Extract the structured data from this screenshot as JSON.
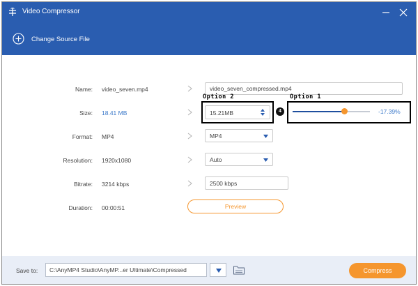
{
  "window": {
    "title": "Video Compressor"
  },
  "source": {
    "label": "Change Source File"
  },
  "rows": {
    "name": {
      "label": "Name:",
      "original": "video_seven.mp4",
      "output": "video_seven_compressed.mp4"
    },
    "size": {
      "label": "Size:",
      "original": "18.41 MB",
      "output": "15.21MB",
      "percent": "-17.39%",
      "slider_fraction": 0.67
    },
    "format": {
      "label": "Format:",
      "original": "MP4",
      "output": "MP4"
    },
    "resolution": {
      "label": "Resolution:",
      "original": "1920x1080",
      "output": "Auto"
    },
    "bitrate": {
      "label": "Bitrate:",
      "original": "3214 kbps",
      "output": "2500 kbps"
    },
    "duration": {
      "label": "Duration:",
      "original": "00:00:51"
    }
  },
  "preview": {
    "label": "Preview"
  },
  "annotations": {
    "option1": "Option 1",
    "option2": "Option 2",
    "step": "4"
  },
  "footer": {
    "save_label": "Save to:",
    "path": "C:\\AnyMP4 Studio\\AnyMP...er Ultimate\\Compressed",
    "compress_label": "Compress"
  },
  "colors": {
    "header": "#2a5db0",
    "accent": "#f5962e",
    "value_blue": "#3a78c9"
  }
}
